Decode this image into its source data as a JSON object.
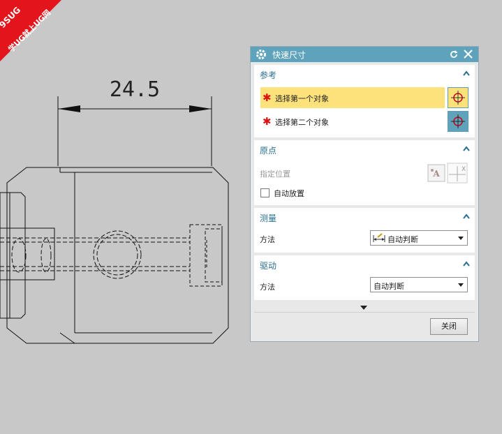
{
  "logo": {
    "line1": "9SUG",
    "line2": "学UG就上UG网"
  },
  "drawing": {
    "dimension": "24.5"
  },
  "dialog": {
    "title": "快速尺寸",
    "sections": {
      "reference": {
        "header": "参考",
        "first_object": "选择第一个对象",
        "second_object": "选择第二个对象"
      },
      "origin": {
        "header": "原点",
        "specify_location": "指定位置",
        "auto_place": "自动放置"
      },
      "measure": {
        "header": "测量",
        "method_label": "方法",
        "method_value": "自动判断"
      },
      "driving": {
        "header": "驱动",
        "method_label": "方法",
        "method_value": "自动判断"
      }
    },
    "close_label": "关闭"
  },
  "colors": {
    "titlebar": "#5ea3bb",
    "section_header": "#2a6f8e",
    "highlight": "#fde27c",
    "required_star": "#dd1111",
    "canvas_bg": "#c8c8c8"
  }
}
